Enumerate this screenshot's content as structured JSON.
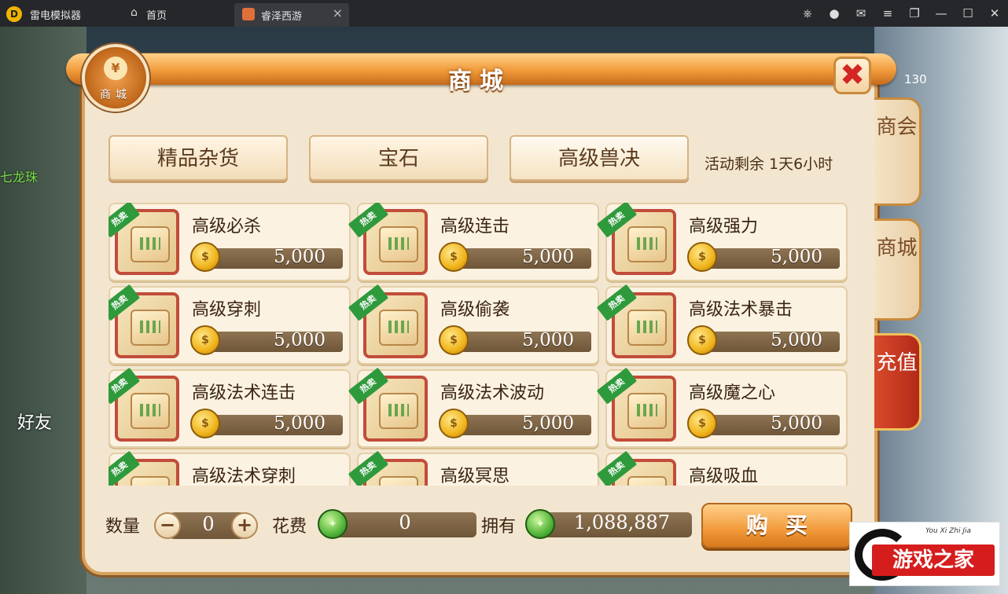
{
  "titlebar": {
    "app_name": "雷电模拟器",
    "home_tab": "首页",
    "game_tab": "睿泽西游",
    "icons": [
      "gamepad-icon",
      "avatar-icon",
      "mail-icon",
      "menu-icon",
      "restore-icon",
      "minimize-icon",
      "maximize-icon",
      "close-icon"
    ]
  },
  "background": {
    "left_text": "七龙珠",
    "friend_label": "好友",
    "level_text": "130"
  },
  "shop": {
    "title": "商城",
    "emblem_label": "商城",
    "emblem_coin": "¥",
    "close_symbol": "✖",
    "side_tabs": [
      "商会",
      "商城",
      "充值"
    ],
    "categories": [
      "精品杂货",
      "宝石",
      "高级兽决"
    ],
    "active_category": "高级兽决",
    "countdown": "活动剩余 1天6小时",
    "hot_badge": "热卖",
    "items": [
      {
        "name": "高级必杀",
        "price": "5,000"
      },
      {
        "name": "高级连击",
        "price": "5,000"
      },
      {
        "name": "高级强力",
        "price": "5,000"
      },
      {
        "name": "高级穿刺",
        "price": "5,000"
      },
      {
        "name": "高级偷袭",
        "price": "5,000"
      },
      {
        "name": "高级法术暴击",
        "price": "5,000"
      },
      {
        "name": "高级法术连击",
        "price": "5,000"
      },
      {
        "name": "高级法术波动",
        "price": "5,000"
      },
      {
        "name": "高级魔之心",
        "price": "5,000"
      },
      {
        "name": "高级法术穿刺",
        "price": ""
      },
      {
        "name": "高级冥思",
        "price": ""
      },
      {
        "name": "高级吸血",
        "price": ""
      }
    ],
    "quantity_label": "数量",
    "quantity_value": "0",
    "minus_symbol": "−",
    "plus_symbol": "+",
    "cost_label": "花费",
    "cost_value": "0",
    "own_label": "拥有",
    "own_value": "1,088,887",
    "buy_label": "购买"
  },
  "watermark": {
    "small": "You Xi Zhi Jia",
    "big": "游戏之家"
  },
  "colors": {
    "frame": "#f3e6d0",
    "accent": "#f19a3a",
    "close": "#d32525",
    "hot_badge": "#2f9a3c",
    "recharge_tab": "#c9341e"
  }
}
